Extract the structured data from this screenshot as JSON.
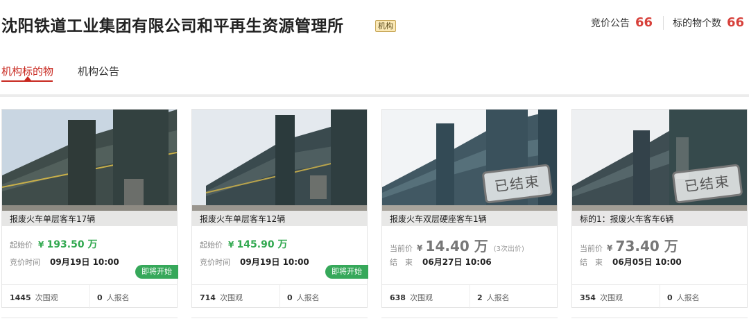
{
  "org": {
    "title": "沈阳铁道工业集团有限公司和平再生资源管理所",
    "badge": "机构"
  },
  "stats": [
    {
      "label": "竞价公告",
      "value": "66"
    },
    {
      "label": "标的物个数",
      "value": "66"
    }
  ],
  "tabs": [
    {
      "label": "机构标的物",
      "active": true
    },
    {
      "label": "机构公告",
      "active": false
    }
  ],
  "colors": {
    "accent_red": "#c8281f",
    "stat_red": "#d7403a",
    "price_green": "#31a84f",
    "soon_tag_green": "#36a85a"
  },
  "cards": [
    {
      "name": "报废火车单层客车17辆",
      "price_label": "起始价",
      "price": "193.50",
      "unit": "万",
      "time_label": "竞价时间",
      "time": "09月19日 10:00",
      "status_tag": "即将开始",
      "views": "1445",
      "views_label": "次围观",
      "signups": "0",
      "signups_label": "人报名"
    },
    {
      "name": "报废火车单层客车12辆",
      "price_label": "起始价",
      "price": "145.90",
      "unit": "万",
      "time_label": "竞价时间",
      "time": "09月19日 10:00",
      "status_tag": "即将开始",
      "views": "714",
      "views_label": "次围观",
      "signups": "0",
      "signups_label": "人报名"
    },
    {
      "name": "报废火车双层硬座客车1辆",
      "price_label": "当前价",
      "price": "14.40",
      "unit": "万",
      "bid_note": "(3次出价)",
      "time_label": "结　束",
      "time": "06月27日 10:06",
      "stamp": "已结束",
      "views": "638",
      "views_label": "次围观",
      "signups": "2",
      "signups_label": "人报名"
    },
    {
      "name": "标的1：报废火车客车6辆",
      "price_label": "当前价",
      "price": "73.40",
      "unit": "万",
      "time_label": "结　束",
      "time": "06月05日 10:00",
      "stamp": "已结束",
      "views": "354",
      "views_label": "次围观",
      "signups": "0",
      "signups_label": "人报名"
    }
  ]
}
